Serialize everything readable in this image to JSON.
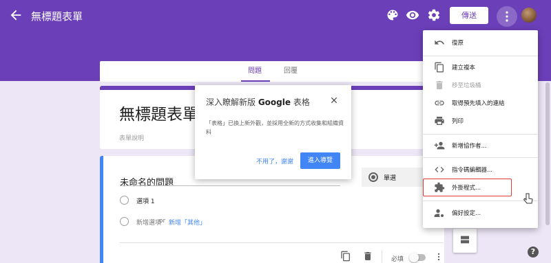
{
  "colors": {
    "header": "#6a3fb8",
    "accent": "#4285f4",
    "highlight": "#e53935"
  },
  "header": {
    "title": "無標題表單",
    "send_label": "傳送",
    "icons": [
      "back-arrow-icon",
      "palette-icon",
      "eye-icon",
      "gear-icon",
      "more-vert-icon"
    ]
  },
  "tabs": {
    "questions": "問題",
    "responses": "回覆"
  },
  "form": {
    "title": "無標題表單",
    "description": "表單說明"
  },
  "question": {
    "title": "未命名的問題",
    "option1": "選項 1",
    "add_option": "新增選項",
    "or": "or",
    "add_other": "新增「其他」",
    "type": "單選",
    "required_label": "必填"
  },
  "dialog": {
    "title_prefix": "深入瞭解新版 ",
    "title_bold": "Google",
    "title_suffix": " 表格",
    "body": "「表格」已換上新外觀，並採用全新的方式收集和組織資料",
    "dismiss": "不用了，謝謝",
    "tour": "進入導覽"
  },
  "menu": {
    "items": [
      {
        "label": "復原",
        "icon": "undo-icon",
        "disabled": false
      },
      {
        "label": "建立複本",
        "icon": "copy-icon",
        "disabled": false
      },
      {
        "label": "移至垃圾桶",
        "icon": "trash-icon",
        "disabled": true
      },
      {
        "label": "取得預先填入的連結",
        "icon": "link-icon",
        "disabled": false
      },
      {
        "label": "列印",
        "icon": "print-icon",
        "disabled": false
      },
      {
        "label": "新增協作者...",
        "icon": "add-person-icon",
        "disabled": false
      },
      {
        "label": "指令碼編輯器...",
        "icon": "code-icon",
        "disabled": false
      },
      {
        "label": "外掛程式...",
        "icon": "puzzle-icon",
        "disabled": false
      },
      {
        "label": "偏好設定...",
        "icon": "person-settings-icon",
        "disabled": false
      }
    ]
  },
  "help": "?"
}
